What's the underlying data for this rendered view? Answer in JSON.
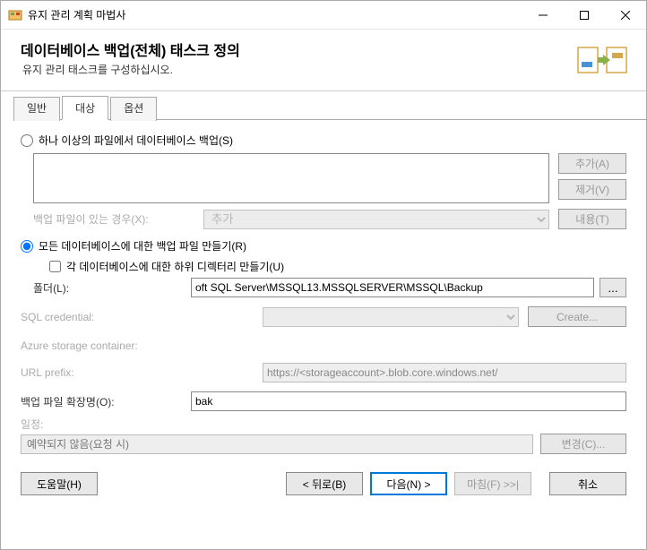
{
  "window": {
    "title": "유지 관리 계획 마법사"
  },
  "header": {
    "title": "데이터베이스 백업(전체) 태스크 정의",
    "subtitle": "유지 관리 태스크를 구성하십시오."
  },
  "tabs": {
    "general": "일반",
    "destination": "대상",
    "options": "옵션"
  },
  "dest": {
    "radio_files": "하나 이상의 파일에서 데이터베이스 백업(S)",
    "btn_add": "추가(A)",
    "btn_remove": "제거(V)",
    "label_if_exists": "백업 파일이 있는 경우(X):",
    "select_if_exists": "추가",
    "btn_contents": "내용(T)",
    "radio_every": "모든 데이터베이스에 대한 백업 파일 만들기(R)",
    "check_subdir": "각 데이터베이스에 대한 하위 디렉터리 만들기(U)",
    "label_folder": "폴더(L):",
    "folder_value": "oft SQL Server\\MSSQL13.MSSQLSERVER\\MSSQL\\Backup",
    "label_sql_cred": "SQL credential:",
    "btn_create": "Create...",
    "label_azure": "Azure storage container:",
    "label_url_prefix": "URL prefix:",
    "url_prefix_value": "https://<storageaccount>.blob.core.windows.net/",
    "label_ext": "백업 파일 확장명(O):",
    "ext_value": "bak"
  },
  "schedule": {
    "label": "일정:",
    "value": "예약되지 않음(요청 시)",
    "btn_change": "변경(C)..."
  },
  "footer": {
    "help": "도움말(H)",
    "back": "< 뒤로(B)",
    "next": "다음(N) >",
    "finish": "마침(F) >>|",
    "cancel": "취소"
  }
}
